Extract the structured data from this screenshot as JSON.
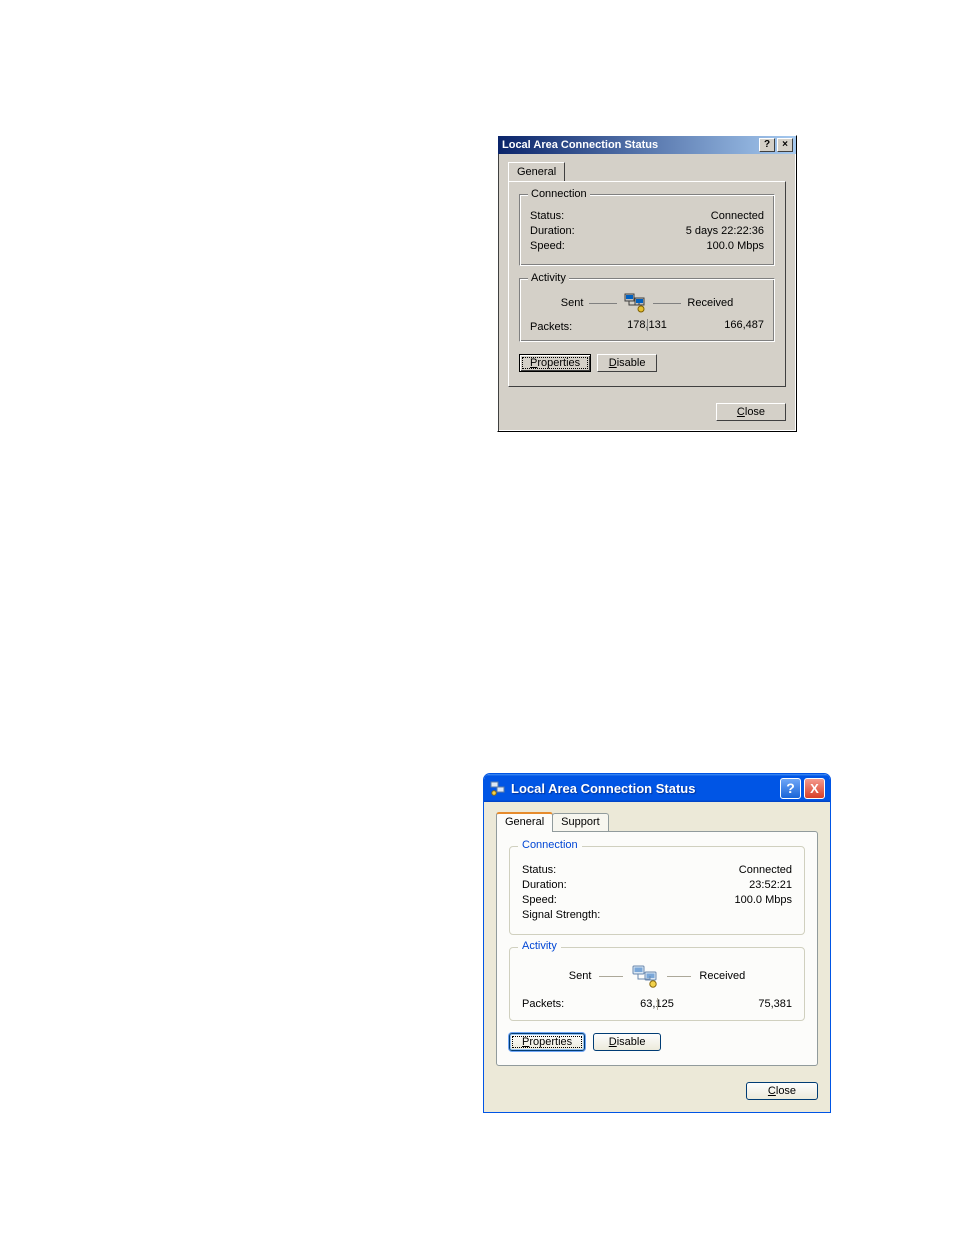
{
  "dialog1": {
    "title": "Local Area Connection Status",
    "help_icon": "?",
    "close_icon": "×",
    "tabs": {
      "general": "General"
    },
    "connection": {
      "legend": "Connection",
      "status_label": "Status:",
      "status_value": "Connected",
      "duration_label": "Duration:",
      "duration_value": "5 days 22:22:36",
      "speed_label": "Speed:",
      "speed_value": "100.0 Mbps"
    },
    "activity": {
      "legend": "Activity",
      "sent_label": "Sent",
      "received_label": "Received",
      "packets_label": "Packets:",
      "sent_value": "178,131",
      "received_value": "166,487"
    },
    "buttons": {
      "properties": "Properties",
      "disable": "Disable",
      "close": "Close"
    }
  },
  "dialog2": {
    "title": "Local Area Connection Status",
    "help_icon": "?",
    "close_icon": "X",
    "tabs": {
      "general": "General",
      "support": "Support"
    },
    "connection": {
      "legend": "Connection",
      "status_label": "Status:",
      "status_value": "Connected",
      "duration_label": "Duration:",
      "duration_value": "23:52:21",
      "speed_label": "Speed:",
      "speed_value": "100.0 Mbps",
      "signal_label": "Signal Strength:",
      "signal_value": ""
    },
    "activity": {
      "legend": "Activity",
      "sent_label": "Sent",
      "received_label": "Received",
      "packets_label": "Packets:",
      "sent_value": "63,125",
      "received_value": "75,381"
    },
    "buttons": {
      "properties": "Properties",
      "disable": "Disable",
      "close": "Close"
    }
  }
}
